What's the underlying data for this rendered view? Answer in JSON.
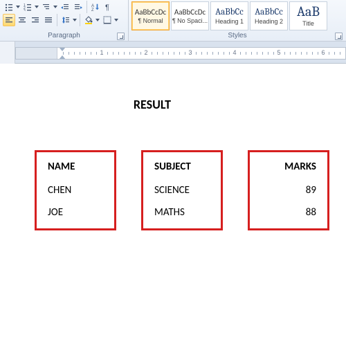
{
  "ribbon": {
    "paragraph_label": "Paragraph",
    "styles_label": "Styles",
    "gallery": [
      {
        "preview": "AaBbCcDc",
        "label": "¶ Normal",
        "selected": true,
        "body": true
      },
      {
        "preview": "AaBbCcDc",
        "label": "¶ No Spaci...",
        "body": true
      },
      {
        "preview": "AaBbCc",
        "label": "Heading 1"
      },
      {
        "preview": "AaBbCc",
        "label": "Heading 2"
      },
      {
        "preview": "AaB",
        "label": "Title",
        "last": true
      }
    ]
  },
  "ruler": {
    "numbers": [
      "1",
      "2",
      "3",
      "4",
      "5",
      "6"
    ]
  },
  "doc": {
    "title": "RESULT",
    "columns": [
      {
        "header": "NAME",
        "rows": [
          "CHEN",
          "JOE"
        ],
        "align": "left"
      },
      {
        "header": "SUBJECT",
        "rows": [
          "SCIENCE",
          "MATHS"
        ],
        "align": "left"
      },
      {
        "header": "MARKS",
        "rows": [
          "89",
          "88"
        ],
        "align": "right"
      }
    ]
  }
}
